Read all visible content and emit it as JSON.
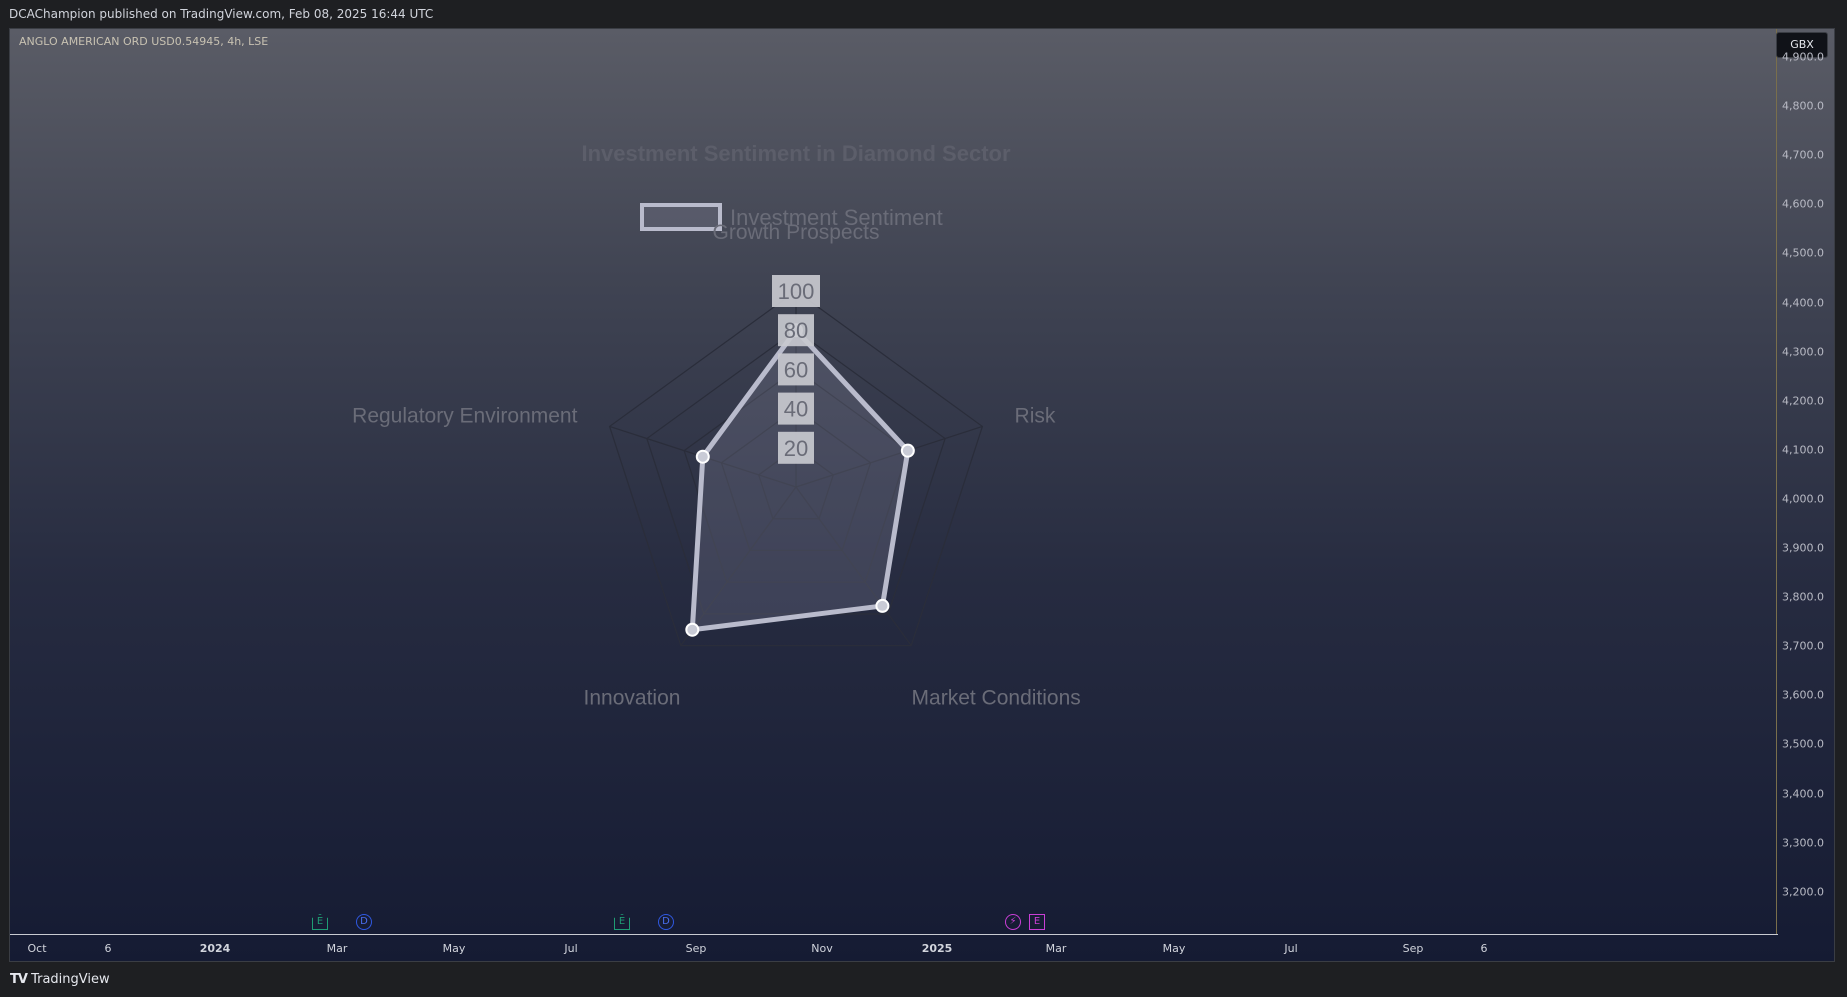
{
  "header": {
    "publish_text": "DCAChampion published on TradingView.com, Feb 08, 2025 16:44 UTC"
  },
  "symbol": {
    "label": "ANGLO AMERICAN ORD USD0.54945, 4h, LSE"
  },
  "price_axis": {
    "currency": "GBX",
    "ticks": [
      "4,900.0",
      "4,800.0",
      "4,700.0",
      "4,600.0",
      "4,500.0",
      "4,400.0",
      "4,300.0",
      "4,200.0",
      "4,100.0",
      "4,000.0",
      "3,900.0",
      "3,800.0",
      "3,700.0",
      "3,600.0",
      "3,500.0",
      "3,400.0",
      "3,300.0",
      "3,200.0"
    ]
  },
  "time_axis": {
    "ticks": [
      {
        "label": "Oct",
        "bold": false
      },
      {
        "label": "6",
        "bold": false
      },
      {
        "label": "2024",
        "bold": true
      },
      {
        "label": "Mar",
        "bold": false
      },
      {
        "label": "May",
        "bold": false
      },
      {
        "label": "Jul",
        "bold": false
      },
      {
        "label": "Sep",
        "bold": false
      },
      {
        "label": "Nov",
        "bold": false
      },
      {
        "label": "2025",
        "bold": true
      },
      {
        "label": "Mar",
        "bold": false
      },
      {
        "label": "May",
        "bold": false
      },
      {
        "label": "Jul",
        "bold": false
      },
      {
        "label": "Sep",
        "bold": false
      },
      {
        "label": "6",
        "bold": false
      }
    ]
  },
  "event_markers": [
    {
      "type": "earnings",
      "glyph": "E"
    },
    {
      "type": "dividend",
      "glyph": "D"
    },
    {
      "type": "earnings",
      "glyph": "E"
    },
    {
      "type": "dividend",
      "glyph": "D"
    },
    {
      "type": "split",
      "glyph": "⚡"
    },
    {
      "type": "earnings-alt",
      "glyph": "E"
    }
  ],
  "colors": {
    "series_stroke": "#b9bbcc",
    "series_fill": "rgba(150,152,175,0.22)",
    "grid": "#2a2d3a",
    "label_text": "#6a6c78",
    "title_text": "#5c5e6a"
  },
  "chart_data": {
    "type": "radar",
    "title": "Investment Sentiment in Diamond Sector",
    "categories": [
      "Growth Prospects",
      "Risk",
      "Market Conditions",
      "Innovation",
      "Regulatory Environment"
    ],
    "series": [
      {
        "name": "Investment Sentiment",
        "values": [
          80,
          60,
          75,
          90,
          50
        ]
      }
    ],
    "r_ticks": [
      "20",
      "40",
      "60",
      "80",
      "100"
    ],
    "r_range": [
      0,
      100
    ],
    "legend": "top-center"
  },
  "footer": {
    "brand": "TradingView",
    "logo_glyph": "𝟏𝟕"
  }
}
